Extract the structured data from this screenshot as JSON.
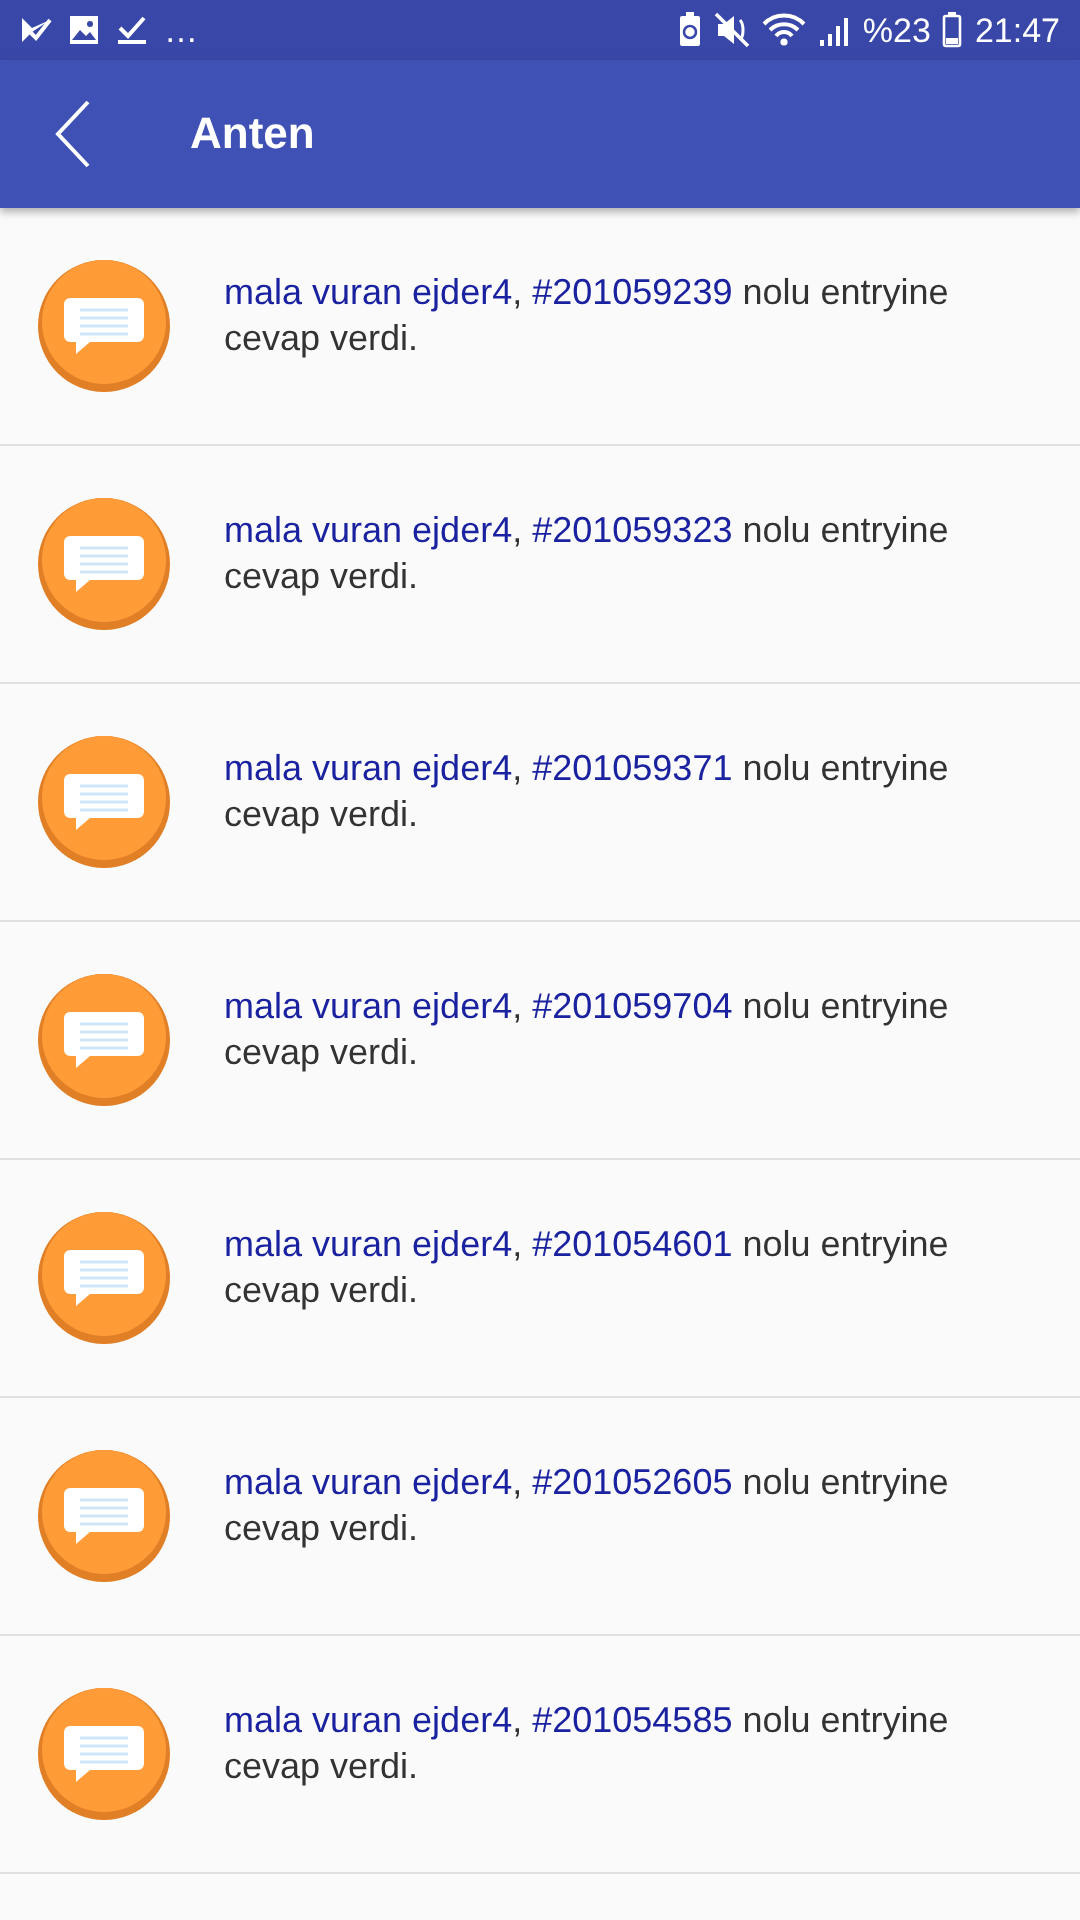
{
  "status_bar": {
    "overflow": "…",
    "battery": "%23",
    "time": "21:47"
  },
  "app_bar": {
    "title": "Anten"
  },
  "notifications": [
    {
      "user": "mala vuran ejder4",
      "separator": ",",
      "entry": "#201059239",
      "suffix": "nolu entryine cevap verdi."
    },
    {
      "user": "mala vuran ejder4",
      "separator": ",",
      "entry": "#201059323",
      "suffix": "nolu entryine cevap verdi."
    },
    {
      "user": "mala vuran ejder4",
      "separator": ",",
      "entry": "#201059371",
      "suffix": "nolu entryine cevap verdi."
    },
    {
      "user": "mala vuran ejder4",
      "separator": ",",
      "entry": "#201059704",
      "suffix": "nolu entryine cevap verdi."
    },
    {
      "user": "mala vuran ejder4",
      "separator": ",",
      "entry": "#201054601",
      "suffix": "nolu entryine cevap verdi."
    },
    {
      "user": "mala vuran ejder4",
      "separator": ",",
      "entry": "#201052605",
      "suffix": "nolu entryine cevap verdi."
    },
    {
      "user": "mala vuran ejder4",
      "separator": ",",
      "entry": "#201054585",
      "suffix": "nolu entryine cevap verdi."
    }
  ]
}
